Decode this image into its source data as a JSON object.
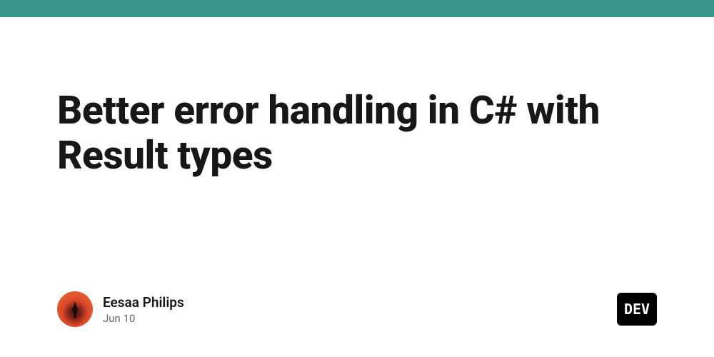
{
  "article": {
    "title": "Better error handling in C# with Result types"
  },
  "author": {
    "name": "Eesaa Philips",
    "date": "Jun 10"
  },
  "brand": {
    "badge": "DEV",
    "accent_color": "#3b948b"
  }
}
